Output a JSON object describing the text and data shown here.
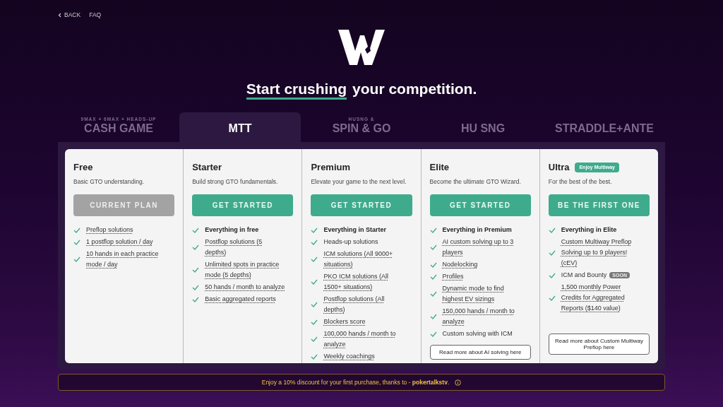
{
  "nav": [
    {
      "label": "BACK",
      "kind": "back"
    },
    {
      "label": "FAQ",
      "kind": "link"
    }
  ],
  "headline": {
    "highlight": "Start crushing",
    "rest": "your competition."
  },
  "tabs": [
    {
      "label": "CASH GAME",
      "sublabel": "9MAX + 6MAX + HEADS-UP",
      "selected": false
    },
    {
      "label": "MTT",
      "selected": true
    },
    {
      "label": "SPIN & GO",
      "sublabel": "HUSNG &",
      "selected": false
    },
    {
      "label": "HU SNG",
      "selected": false
    },
    {
      "label": "STRADDLE+ANTE",
      "selected": false
    }
  ],
  "plans": [
    {
      "name": "Free",
      "tagline": "Basic GTO understanding.",
      "button": {
        "label": "CURRENT PLAN",
        "kind": "current"
      },
      "features": [
        {
          "text": "Preflop solutions",
          "kind": "link"
        },
        {
          "text": "1 postflop solution / day",
          "kind": "link"
        },
        {
          "text": "10 hands in each practice mode / day",
          "kind": "link"
        }
      ]
    },
    {
      "name": "Starter",
      "tagline": "Build strong GTO fundamentals.",
      "button": {
        "label": "GET STARTED",
        "kind": "primary"
      },
      "features": [
        {
          "text": "Everything in free",
          "kind": "bold"
        },
        {
          "text": "Postflop solutions (5 depths)",
          "kind": "link"
        },
        {
          "text": "Unlimited spots in practice mode (5 depths)",
          "kind": "link"
        },
        {
          "text": "50 hands / month to analyze",
          "kind": "link"
        },
        {
          "text": "Basic aggregated reports",
          "kind": "link"
        }
      ]
    },
    {
      "name": "Premium",
      "tagline": "Elevate your game to the next level.",
      "button": {
        "label": "GET STARTED",
        "kind": "primary"
      },
      "features": [
        {
          "text": "Everything in Starter",
          "kind": "bold"
        },
        {
          "text": "Heads-up solutions",
          "kind": "plain"
        },
        {
          "text": "ICM solutions (All 9000+ situations)",
          "kind": "link"
        },
        {
          "text": "PKO ICM solutions (All 1500+ situations)",
          "kind": "link"
        },
        {
          "text": "Postflop solutions (All depths)",
          "kind": "link"
        },
        {
          "text": "Blockers score",
          "kind": "link"
        },
        {
          "text": "100,000 hands / month to analyze",
          "kind": "link"
        },
        {
          "text": "Weekly coachings",
          "kind": "link"
        }
      ]
    },
    {
      "name": "Elite",
      "tagline": "Become the ultimate GTO Wizard.",
      "button": {
        "label": "GET STARTED",
        "kind": "primary"
      },
      "features": [
        {
          "text": "Everything in Premium",
          "kind": "bold"
        },
        {
          "text": "AI custom solving up to 3 players",
          "kind": "link"
        },
        {
          "text": "Nodelocking",
          "kind": "link"
        },
        {
          "text": "Profiles",
          "kind": "link"
        },
        {
          "text": "Dynamic mode to find highest EV sizings",
          "kind": "link"
        },
        {
          "text": "150,000 hands / month to analyze",
          "kind": "link"
        },
        {
          "text": "Custom solving with ICM",
          "kind": "plain"
        }
      ],
      "more": "Read more about AI solving here"
    },
    {
      "name": "Ultra",
      "badge": "Enjoy Multiway",
      "tagline": "For the best of the best.",
      "button": {
        "label": "BE THE FIRST ONE",
        "kind": "primary"
      },
      "features": [
        {
          "text": "Everything in Elite",
          "kind": "bold"
        },
        {
          "text": "Custom Multiway Preflop Solving up to 9 players! (cEV)",
          "kind": "link"
        },
        {
          "text": "ICM and Bounty",
          "kind": "plain",
          "badge": "SOON"
        },
        {
          "text": "1,500 monthly Power Credits for Aggregated Reports ($140 value)",
          "kind": "link"
        }
      ],
      "more": "Read more about Custom Multiway Preflop here",
      "more_bottom": true
    }
  ],
  "banner": {
    "text": "Enjoy a 10% discount for your first purchase, thanks to - **pokertalkstv**."
  }
}
